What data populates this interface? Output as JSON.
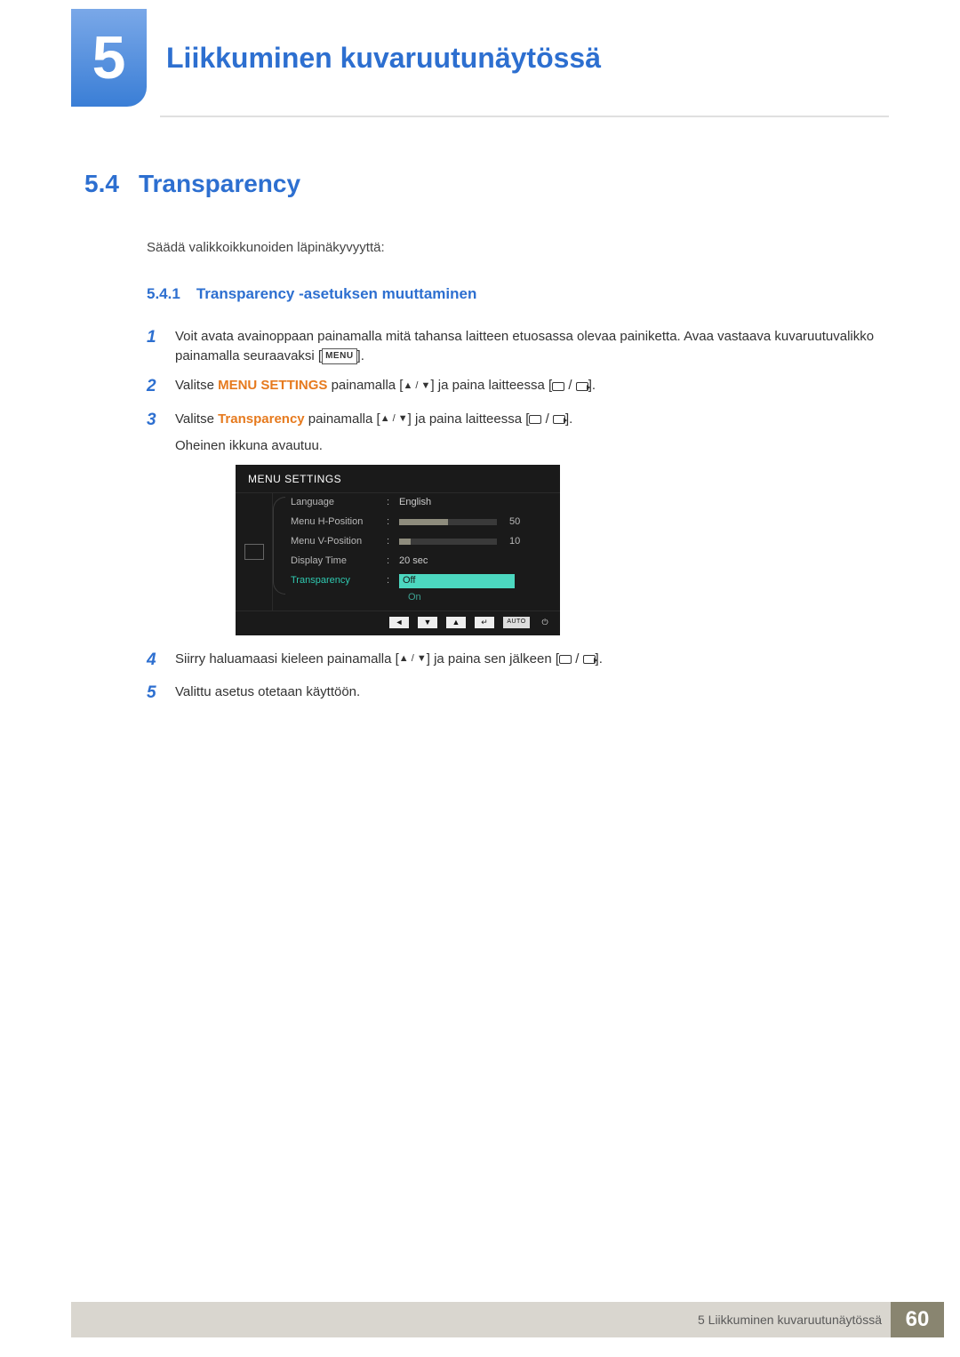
{
  "header": {
    "chapter_number": "5",
    "chapter_title": "Liikkuminen kuvaruutunäytössä"
  },
  "section": {
    "num": "5.4",
    "title": "Transparency",
    "intro": "Säädä valikkoikkunoiden läpinäkyvyyttä:"
  },
  "subsection": {
    "num": "5.4.1",
    "title": "Transparency -asetuksen muuttaminen"
  },
  "steps": {
    "s1": {
      "n": "1",
      "a": "Voit avata avainoppaan painamalla mitä tahansa laitteen etuosassa olevaa painiketta. Avaa vastaava kuvaruutuvalikko painamalla seuraavaksi [",
      "b": "].",
      "menu": "MENU"
    },
    "s2": {
      "n": "2",
      "a": "Valitse ",
      "ms": "MENU SETTINGS",
      "b": " painamalla [",
      "c": "] ja paina laitteessa [",
      "d": "]."
    },
    "s3": {
      "n": "3",
      "a": "Valitse ",
      "tp": "Transparency",
      "b": " painamalla [",
      "c": "] ja paina laitteessa [",
      "d": "].",
      "sub": "Oheinen ikkuna avautuu."
    },
    "s4": {
      "n": "4",
      "a": "Siirry haluamaasi kieleen painamalla [",
      "b": "] ja paina sen jälkeen [",
      "c": "]."
    },
    "s5": {
      "n": "5",
      "a": "Valittu asetus otetaan käyttöön."
    }
  },
  "osd": {
    "title": "MENU SETTINGS",
    "rows": {
      "language": {
        "label": "Language",
        "value": "English"
      },
      "hpos": {
        "label": "Menu H-Position",
        "value": "50"
      },
      "vpos": {
        "label": "Menu V-Position",
        "value": "10"
      },
      "dtime": {
        "label": "Display Time",
        "value": "20 sec"
      },
      "trans": {
        "label": "Transparency",
        "off": "Off",
        "on": "On"
      }
    },
    "footer_auto": "AUTO"
  },
  "footer": {
    "text": "5 Liikkuminen kuvaruutunäytössä",
    "page": "60"
  }
}
